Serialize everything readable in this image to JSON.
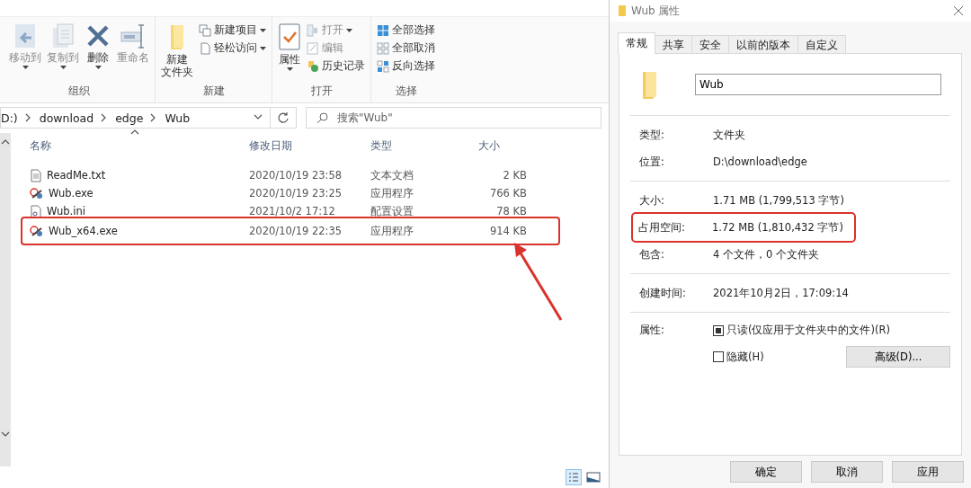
{
  "ribbon": {
    "groups": [
      {
        "label": "组织",
        "large": [
          {
            "lines": [
              "移动到"
            ],
            "disabled": true,
            "dropdown": true
          },
          {
            "lines": [
              "复制到"
            ],
            "disabled": true,
            "dropdown": true
          },
          {
            "lines": [
              "删除"
            ],
            "disabled": false,
            "dropdown": true
          },
          {
            "lines": [
              "重命名"
            ],
            "disabled": true,
            "dropdown": false
          }
        ]
      },
      {
        "label": "新建",
        "large": [
          {
            "lines": [
              "新建",
              "文件夹"
            ],
            "disabled": false,
            "dropdown": false
          }
        ],
        "small": [
          {
            "label": "新建项目",
            "disabled": false,
            "dropdown": true
          },
          {
            "label": "轻松访问",
            "disabled": false,
            "dropdown": true
          }
        ]
      },
      {
        "label": "打开",
        "large": [
          {
            "lines": [
              "属性"
            ],
            "disabled": false,
            "dropdown": true
          }
        ],
        "small": [
          {
            "label": "打开",
            "disabled": true,
            "dropdown": true
          },
          {
            "label": "编辑",
            "disabled": true,
            "dropdown": false
          },
          {
            "label": "历史记录",
            "disabled": false,
            "dropdown": false
          }
        ]
      },
      {
        "label": "选择",
        "small": [
          {
            "label": "全部选择",
            "disabled": false,
            "dropdown": false
          },
          {
            "label": "全部取消",
            "disabled": false,
            "dropdown": false
          },
          {
            "label": "反向选择",
            "disabled": false,
            "dropdown": false
          }
        ]
      }
    ]
  },
  "address_bar": {
    "path": [
      "D:)",
      "download",
      "edge",
      "Wub"
    ]
  },
  "search": {
    "placeholder": "搜索\"Wub\""
  },
  "file_list": {
    "columns": [
      "名称",
      "修改日期",
      "类型",
      "大小"
    ],
    "rows": [
      {
        "name": "ReadMe.txt",
        "date": "2020/10/19 23:58",
        "type": "文本文档",
        "size": "2 KB",
        "kind": "text",
        "highlighted": false
      },
      {
        "name": "Wub.exe",
        "date": "2020/10/19 23:25",
        "type": "应用程序",
        "size": "766 KB",
        "kind": "exe",
        "highlighted": false
      },
      {
        "name": "Wub.ini",
        "date": "2021/10/2 17:12",
        "type": "配置设置",
        "size": "78 KB",
        "kind": "ini",
        "highlighted": false
      },
      {
        "name": "Wub_x64.exe",
        "date": "2020/10/19 22:35",
        "type": "应用程序",
        "size": "914 KB",
        "kind": "exe",
        "highlighted": true
      }
    ]
  },
  "properties_dialog": {
    "title": "Wub 属性",
    "tabs": [
      {
        "label": "常规",
        "selected": true
      },
      {
        "label": "共享",
        "selected": false
      },
      {
        "label": "安全",
        "selected": false
      },
      {
        "label": "以前的版本",
        "selected": false
      },
      {
        "label": "自定义",
        "selected": false
      }
    ],
    "name_field": {
      "value": "Wub"
    },
    "sections": [
      [
        {
          "label": "类型:",
          "value": "文件夹",
          "highlighted": false
        },
        {
          "label": "位置:",
          "value": "D:\\download\\edge",
          "highlighted": false
        }
      ],
      [
        {
          "label": "大小:",
          "value": "1.71 MB (1,799,513 字节)",
          "highlighted": false
        },
        {
          "label": "占用空间:",
          "value": "1.72 MB (1,810,432 字节)",
          "highlighted": true
        },
        {
          "label": "包含:",
          "value": "4 个文件，0 个文件夹",
          "highlighted": false
        }
      ],
      [
        {
          "label": "创建时间:",
          "value": "2021年10月2日，17:09:14",
          "highlighted": false
        }
      ]
    ],
    "attributes": {
      "label": "属性:",
      "checkboxes": [
        {
          "label": "只读(仅应用于文件夹中的文件)(R)",
          "checked": true
        },
        {
          "label": "隐藏(H)",
          "checked": false
        }
      ],
      "advanced_button": "高级(D)..."
    },
    "buttons": [
      "确定",
      "取消",
      "应用"
    ]
  }
}
